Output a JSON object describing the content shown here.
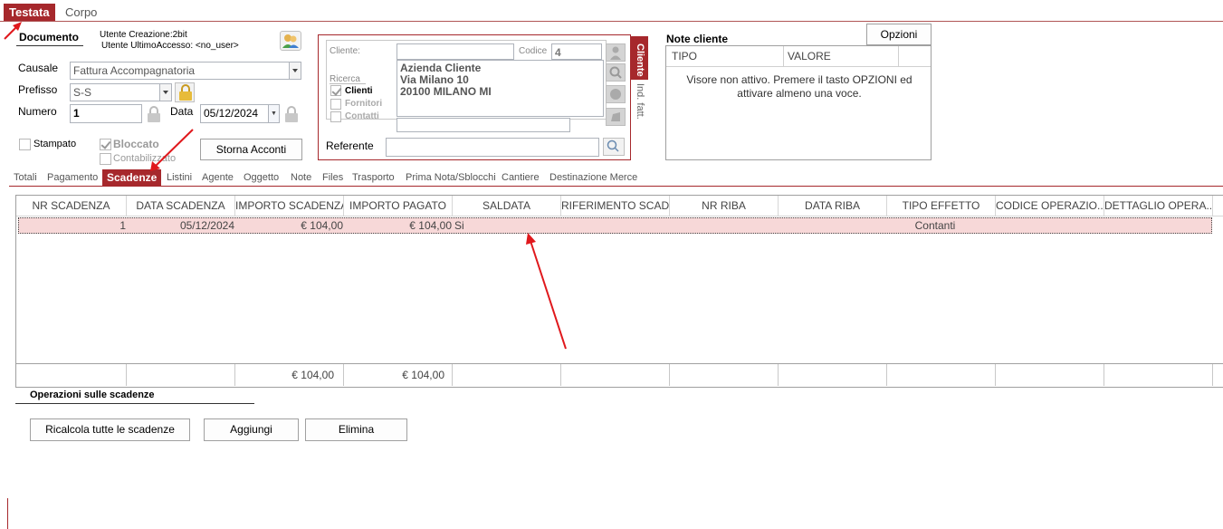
{
  "top_tabs": {
    "testata": "Testata",
    "corpo": "Corpo"
  },
  "documento": {
    "title": "Documento",
    "utente_creazione": "Utente Creazione:2bit",
    "utente_accesso": "Utente UltimoAccesso: <no_user>",
    "causale_label": "Causale",
    "causale_value": "Fattura Accompagnatoria",
    "prefisso_label": "Prefisso",
    "prefisso_value": "S-S",
    "numero_label": "Numero",
    "numero_value": "1",
    "data_label": "Data",
    "data_value": "05/12/2024",
    "stampato_label": "Stampato",
    "stampato_checked": false,
    "bloccato_label": "Bloccato",
    "bloccato_checked": true,
    "contabilizzato_label": "Contabilizzato",
    "contabilizzato_checked": false,
    "storna_button": "Storna Acconti"
  },
  "cliente": {
    "cliente_label": "Cliente:",
    "cliente_value": "",
    "codice_label": "Codice",
    "codice_value": "4",
    "ricerca_label": "Ricerca",
    "options": [
      {
        "label": "Clienti",
        "checked": true
      },
      {
        "label": "Fornitori",
        "checked": false
      },
      {
        "label": "Contatti",
        "checked": false
      }
    ],
    "address_lines": [
      "Azienda Cliente",
      "Via Milano 10",
      "20100 MILANO MI"
    ],
    "referente_label": "Referente",
    "referente_value": "",
    "tab_cliente": "Cliente",
    "tab_ind_fatt": "Ind. fatt."
  },
  "notes": {
    "title": "Note cliente",
    "options_button": "Opzioni",
    "col_tipo": "TIPO",
    "col_valore": "VALORE",
    "message": "Visore non attivo. Premere il tasto OPZIONI ed attivare almeno una voce."
  },
  "sub_tabs": [
    "Totali",
    "Pagamento",
    "Scadenze",
    "Listini",
    "Agente",
    "Oggetto",
    "Note",
    "Files",
    "Trasporto",
    "Prima Nota/Sblocchi",
    "Cantiere",
    "Destinazione Merce"
  ],
  "active_sub_tab": "Scadenze",
  "grid": {
    "columns": [
      "NR SCADENZA",
      "DATA SCADENZA",
      "IMPORTO SCADENZA",
      "IMPORTO PAGATO",
      "SALDATA",
      "RIFERIMENTO SCAD...",
      "NR RIBA",
      "DATA RIBA",
      "TIPO EFFETTO",
      "CODICE OPERAZIO...",
      "DETTAGLIO OPERA..."
    ],
    "rows": [
      {
        "nr": "1",
        "data": "05/12/2024",
        "importo": "€ 104,00",
        "pagato": "€ 104,00",
        "saldata": "Si",
        "riferimento": "",
        "nr_riba": "",
        "data_riba": "",
        "tipo_effetto": "Contanti",
        "codice": "",
        "dettaglio": ""
      }
    ],
    "totals": {
      "importo": "€ 104,00",
      "pagato": "€ 104,00"
    }
  },
  "operations": {
    "title": "Operazioni sulle scadenze",
    "ricalcola": "Ricalcola tutte le scadenze",
    "aggiungi": "Aggiungi",
    "elimina": "Elimina"
  },
  "colors": {
    "accent": "#a6282c",
    "row_highlight": "#f7d8d8",
    "annotation_arrow": "#e0181c"
  }
}
